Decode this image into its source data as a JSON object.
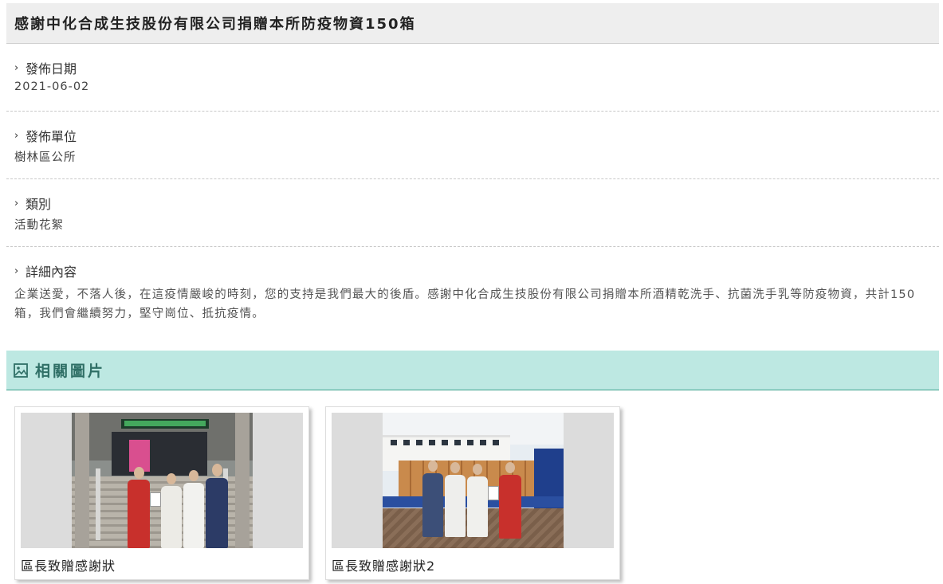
{
  "article": {
    "title": "感謝中化合成生技股份有限公司捐贈本所防疫物資150箱"
  },
  "fields": [
    {
      "label": "發佈日期",
      "value": "2021-06-02"
    },
    {
      "label": "發佈單位",
      "value": "樹林區公所"
    },
    {
      "label": "類別",
      "value": "活動花絮"
    },
    {
      "label": "詳細內容",
      "value": "企業送愛，不落人後，在這疫情嚴峻的時刻，您的支持是我們最大的後盾。感謝中化合成生技股份有限公司捐贈本所酒精乾洗手、抗菌洗手乳等防疫物資，共計150箱，我們會繼續努力，堅守崗位、抵抗疫情。"
    }
  ],
  "related": {
    "heading": "相關圖片",
    "icon": "image-icon",
    "images": [
      {
        "caption": "區長致贈感謝狀"
      },
      {
        "caption": "區長致贈感謝狀2"
      }
    ]
  },
  "colors": {
    "title_bg": "#eeeeee",
    "related_bg": "#bde8e2",
    "related_text": "#2f6f66",
    "related_border": "#3aa08c"
  }
}
